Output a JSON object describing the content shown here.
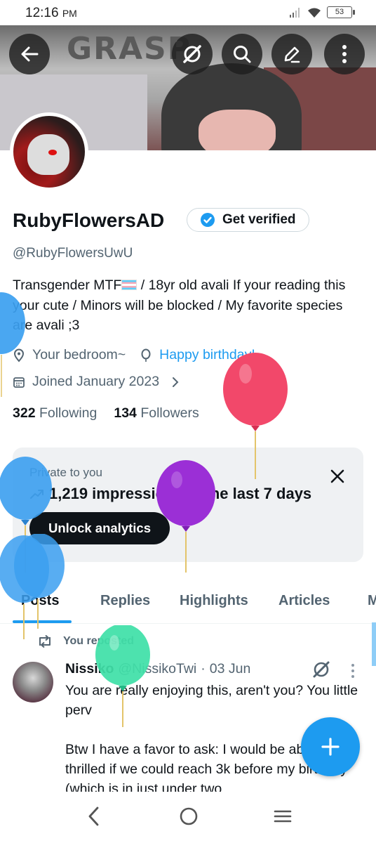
{
  "status_bar": {
    "time": "12:16",
    "ampm": "PM",
    "battery": "53"
  },
  "banner": {
    "text": "GRASP"
  },
  "profile": {
    "display_name": "RubyFlowersAD",
    "get_verified_label": "Get verified",
    "handle": "@RubyFlowersUwU",
    "bio_part1": "Transgender MTF",
    "bio_part2": " / 18yr old avali   If your reading this your cute /  Minors will be blocked / My favorite species are avali ;3",
    "location": "Your bedroom~",
    "birthday": "Happy birthday!",
    "joined": "Joined January 2023",
    "following_count": "322",
    "following_label": "Following",
    "followers_count": "134",
    "followers_label": "Followers"
  },
  "analytics_card": {
    "private_label": "Private to you",
    "impressions": "1,219 impressions in the last 7 days",
    "unlock_label": "Unlock analytics"
  },
  "tabs": [
    "Posts",
    "Replies",
    "Highlights",
    "Articles",
    "M"
  ],
  "post": {
    "repost_label": "You reposted",
    "author_name": "Nissiko",
    "author_handle": "@NissikoTwi",
    "separator": "·",
    "date": "03 Jun",
    "body": "You are really enjoying this, aren't you? You little perv\n\nBtw I have a favor to ask: I would be absolutely thrilled if we could reach 3k before my birthday (which is in just under two"
  },
  "colors": {
    "accent_blue": "#1d9bf0",
    "text_primary": "#0f1419",
    "text_secondary": "#536471",
    "card_bg": "#eff1f3",
    "balloon_blue": "#3b9ff0",
    "balloon_pink": "#f2486a",
    "balloon_purple": "#9b2fd6",
    "balloon_green": "#3fe0a8"
  },
  "icons": {
    "back": "arrow-left-icon",
    "grok": "grok-slash-icon",
    "search": "search-icon",
    "edit": "pencil-icon",
    "more": "more-vertical-icon",
    "location": "location-pin-icon",
    "birthday": "balloon-icon",
    "calendar": "calendar-icon",
    "chevron": "chevron-right-icon",
    "trend": "trend-arrow-icon",
    "close": "close-icon",
    "repost": "repost-icon",
    "compose": "plus-icon"
  }
}
